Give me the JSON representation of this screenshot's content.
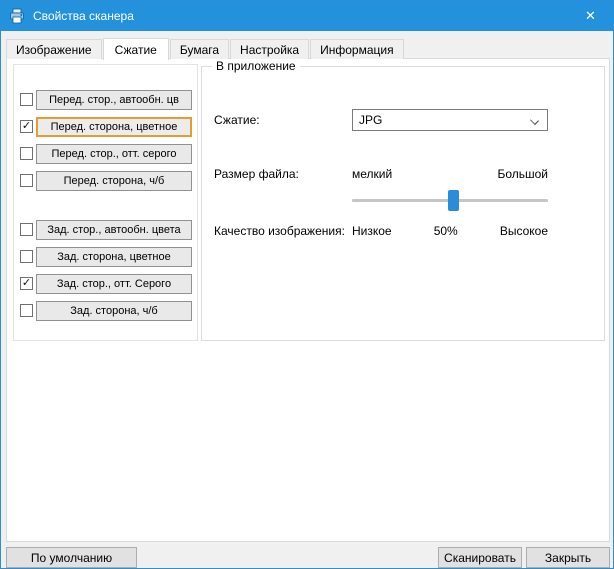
{
  "window": {
    "title": "Свойства сканера"
  },
  "glyphs": {
    "check": "✓",
    "close": "✕"
  },
  "tabs": [
    {
      "label": "Изображение",
      "active": false
    },
    {
      "label": "Сжатие",
      "active": true
    },
    {
      "label": "Бумага",
      "active": false
    },
    {
      "label": "Настройка",
      "active": false
    },
    {
      "label": "Информация",
      "active": false
    }
  ],
  "scan_sides": {
    "front": [
      {
        "label": "Перед. стор., автообн. цв",
        "checked": false,
        "selected": false
      },
      {
        "label": "Перед. сторона, цветное",
        "checked": true,
        "selected": true
      },
      {
        "label": "Перед. стор., отт. серого",
        "checked": false,
        "selected": false
      },
      {
        "label": "Перед. сторона, ч/б",
        "checked": false,
        "selected": false
      }
    ],
    "back": [
      {
        "label": "Зад. стор., автообн. цвета",
        "checked": false,
        "selected": false
      },
      {
        "label": "Зад. сторона, цветное",
        "checked": false,
        "selected": false
      },
      {
        "label": "Зад. стор., отт. Серого",
        "checked": true,
        "selected": false
      },
      {
        "label": "Зад. сторона, ч/б",
        "checked": false,
        "selected": false
      }
    ]
  },
  "group": {
    "title": "В приложение",
    "compression_label": "Сжатие:",
    "compression_value": "JPG",
    "file_size_label": "Размер файла:",
    "file_size_min": "мелкий",
    "file_size_max": "Большой",
    "quality_label": "Качество изображения:",
    "quality_min": "Низкое",
    "quality_value": "50%",
    "quality_max": "Высокое",
    "slider_percent": 50
  },
  "footer": {
    "default": "По умолчанию",
    "scan": "Сканировать",
    "close": "Закрыть"
  },
  "colors": {
    "titlebar": "#2491dc",
    "accent": "#2b8dd9",
    "selected_border": "#e49c33"
  }
}
